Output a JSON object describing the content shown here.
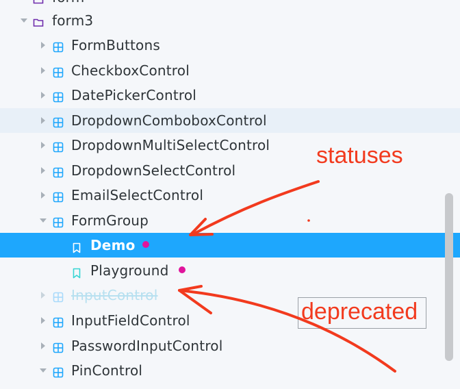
{
  "tree": {
    "items": [
      {
        "label": "form",
        "depth": 0,
        "kind": "folder",
        "expanded": false
      },
      {
        "label": "form3",
        "depth": 0,
        "kind": "folder",
        "expanded": true
      },
      {
        "label": "FormButtons",
        "depth": 1,
        "kind": "component"
      },
      {
        "label": "CheckboxControl",
        "depth": 1,
        "kind": "component"
      },
      {
        "label": "DatePickerControl",
        "depth": 1,
        "kind": "component"
      },
      {
        "label": "DropdownComboboxControl",
        "depth": 1,
        "kind": "component",
        "hovered": true
      },
      {
        "label": "DropdownMultiSelectControl",
        "depth": 1,
        "kind": "component"
      },
      {
        "label": "DropdownSelectControl",
        "depth": 1,
        "kind": "component"
      },
      {
        "label": "EmailSelectControl",
        "depth": 1,
        "kind": "component"
      },
      {
        "label": "FormGroup",
        "depth": 1,
        "kind": "component",
        "expanded": true
      },
      {
        "label": "Demo",
        "depth": 2,
        "kind": "story",
        "selected": true,
        "status": "magenta-dot"
      },
      {
        "label": "Playground",
        "depth": 2,
        "kind": "story",
        "status": "magenta-dot"
      },
      {
        "label": "InputControl",
        "depth": 1,
        "kind": "component",
        "deprecated": true
      },
      {
        "label": "InputFieldControl",
        "depth": 1,
        "kind": "component"
      },
      {
        "label": "PasswordInputControl",
        "depth": 1,
        "kind": "component"
      },
      {
        "label": "PinControl",
        "depth": 1,
        "kind": "component",
        "expanded": true
      }
    ]
  },
  "annotations": {
    "statuses": "statuses",
    "deprecated": "deprecated"
  },
  "colors": {
    "selected_bg": "#1ea7fd",
    "hover_bg": "#e8f0f8",
    "status_dot": "#e0159c",
    "annotation": "#f23a1e",
    "folder_icon": "#6f2cac",
    "component_icon": "#1ea7fd",
    "story_icon": "#37d5d3"
  }
}
